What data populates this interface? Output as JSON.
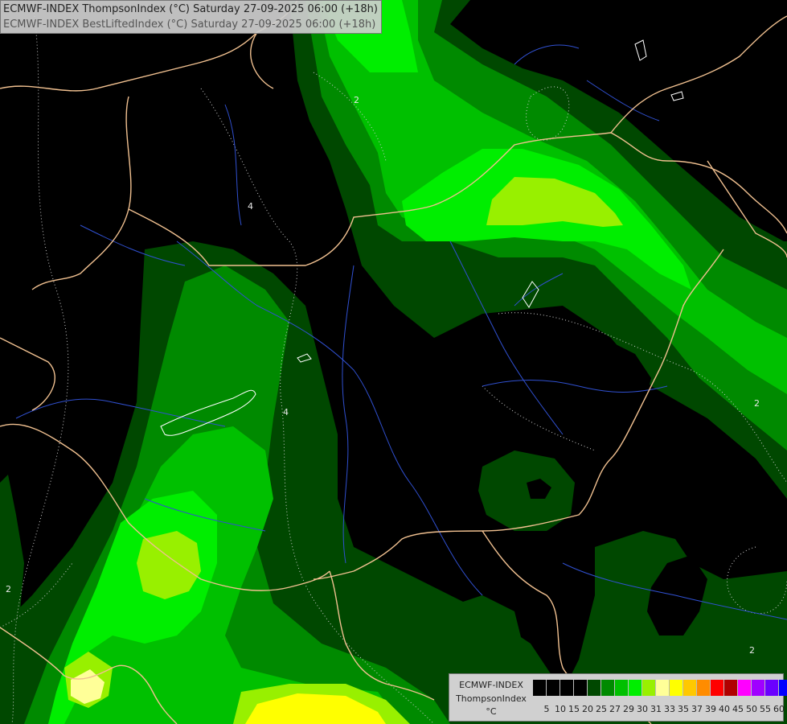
{
  "title": {
    "line1": "ECMWF-INDEX ThompsonIndex (°C) Saturday 27-09-2025 06:00 (+18h)",
    "line2": "ECMWF-INDEX BestLiftedIndex (°C) Saturday 27-09-2025 06:00 (+18h)"
  },
  "legend": {
    "model": "ECMWF-INDEX",
    "parameter": "ThompsonIndex",
    "unit": "°C",
    "colors": [
      "#000000",
      "#000000",
      "#000000",
      "#000000",
      "#004800",
      "#008a00",
      "#00c000",
      "#00ee00",
      "#98f000",
      "#ffff98",
      "#ffff00",
      "#ffc800",
      "#ff8c00",
      "#ff0000",
      "#b00000",
      "#ff00ff",
      "#a000ff",
      "#6a00ff",
      "#0000ff"
    ],
    "ticks": [
      "5",
      "10",
      "15",
      "20",
      "25",
      "27",
      "29",
      "30",
      "31",
      "33",
      "35",
      "37",
      "39",
      "40",
      "45",
      "50",
      "55",
      "60"
    ]
  },
  "isoline_labels": [
    "2",
    "4",
    "4",
    "2",
    "2",
    "2"
  ],
  "palette": {
    "dark_green": "#004800",
    "green": "#008a00",
    "bright_green": "#00c000",
    "lime": "#00ee00",
    "yellow_green": "#98f000",
    "pale_yellow": "#ffff98",
    "yellow": "#ffff00",
    "border": "#f0c090",
    "river": "#3050d0",
    "isoline": "#cfcfcf"
  }
}
